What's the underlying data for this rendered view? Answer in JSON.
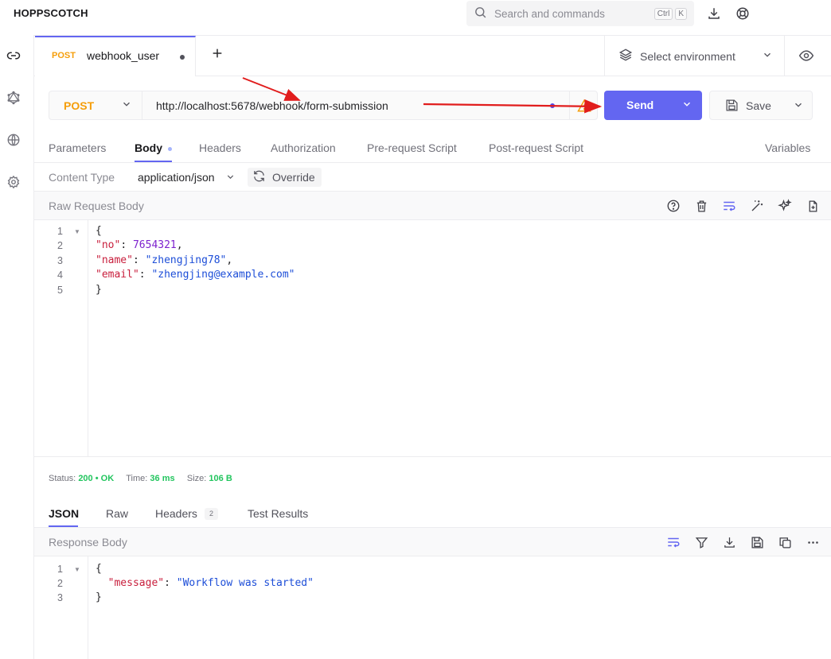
{
  "app": {
    "title": "HOPPSCOTCH"
  },
  "search": {
    "placeholder": "Search and commands",
    "shortcut_ctrl": "Ctrl",
    "shortcut_key": "K"
  },
  "tabs": [
    {
      "method": "POST",
      "name": "webhook_user",
      "modified": true
    }
  ],
  "environment": {
    "label": "Select environment"
  },
  "request": {
    "method": "POST",
    "url": "http://localhost:5678/webhook/form-submission",
    "send_label": "Send",
    "save_label": "Save"
  },
  "request_tabs": [
    "Parameters",
    "Body",
    "Headers",
    "Authorization",
    "Pre-request Script",
    "Post-request Script"
  ],
  "request_tabs_active": "Body",
  "variables_label": "Variables",
  "content_type": {
    "label": "Content Type",
    "value": "application/json",
    "override_label": "Override"
  },
  "raw_body": {
    "title": "Raw Request Body",
    "line_numbers": [
      "1",
      "2",
      "3",
      "4",
      "5"
    ],
    "json": {
      "no": "7654321",
      "name": "\"zhengjing78\"",
      "email": "\"zhengjing@example.com\""
    },
    "keys": {
      "no": "\"no\"",
      "name": "\"name\"",
      "email": "\"email\""
    }
  },
  "status": {
    "status_label": "Status:",
    "status_value": "200",
    "status_text": "OK",
    "time_label": "Time:",
    "time_value": "36 ms",
    "size_label": "Size:",
    "size_value": "106 B"
  },
  "response_tabs": [
    {
      "label": "JSON"
    },
    {
      "label": "Raw"
    },
    {
      "label": "Headers",
      "badge": "2"
    },
    {
      "label": "Test Results"
    }
  ],
  "response_body": {
    "title": "Response Body",
    "line_numbers": [
      "1",
      "2",
      "3"
    ],
    "key": "\"message\"",
    "value": "\"Workflow was started\""
  },
  "colors": {
    "accent": "#6366f1",
    "method": "#f59e0b",
    "ok": "#22c55e",
    "annotation": "#e11d1d"
  },
  "icons": {
    "rail": [
      "link-icon",
      "graphql-icon",
      "globe-icon",
      "settings-icon"
    ],
    "top": [
      "download-icon",
      "support-icon"
    ],
    "raw_body_actions": [
      "help-icon",
      "trash-icon",
      "wrap-icon",
      "magic-wand-icon",
      "sparkles-icon",
      "file-import-icon"
    ],
    "response_actions": [
      "wrap-icon",
      "filter-icon",
      "download-icon",
      "save-icon",
      "copy-icon",
      "more-icon"
    ]
  }
}
